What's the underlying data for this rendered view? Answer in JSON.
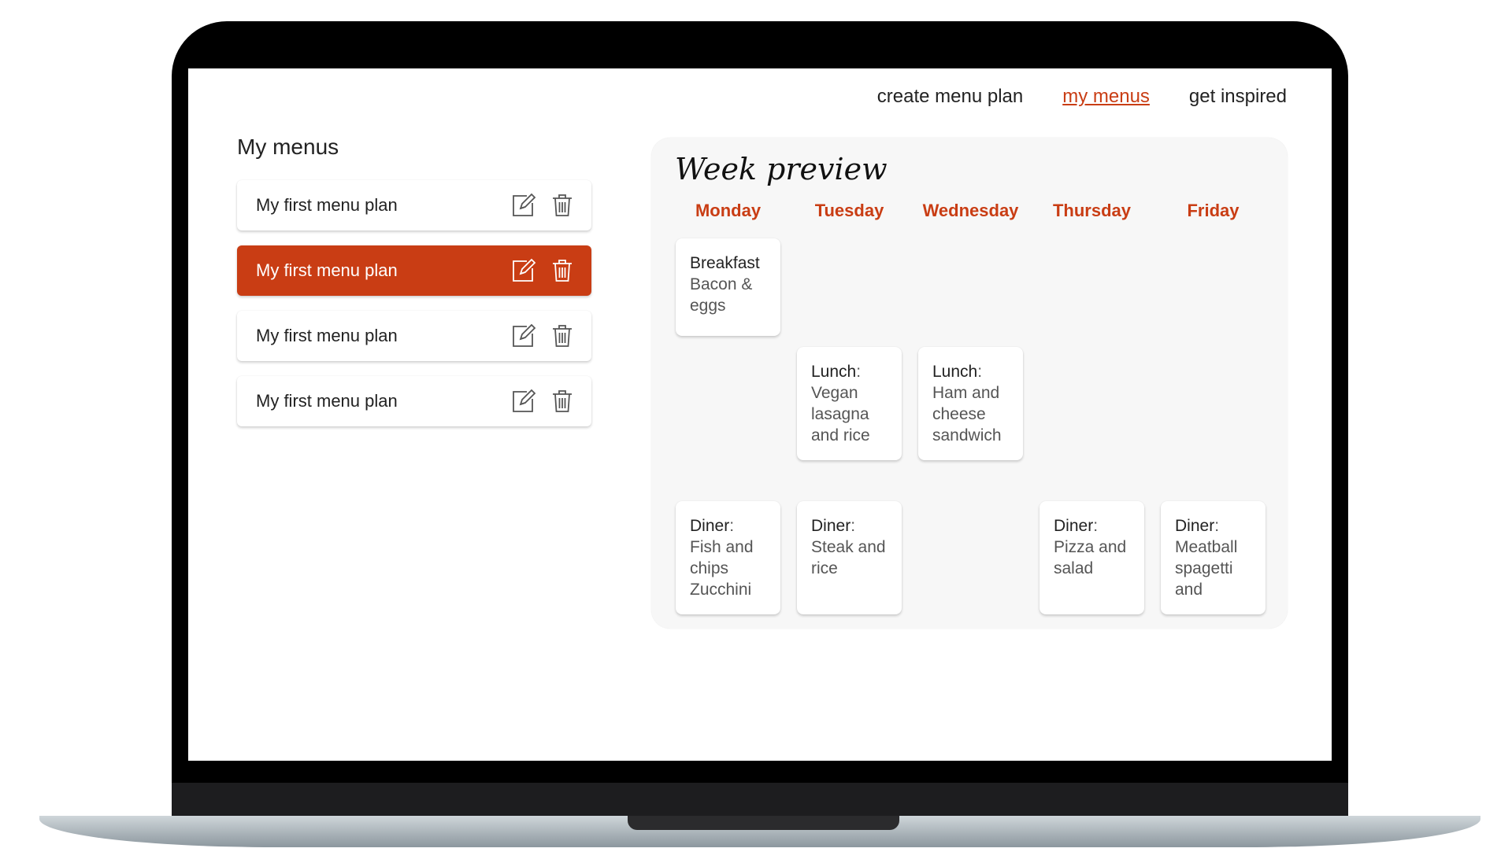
{
  "nav": {
    "items": [
      "create menu plan",
      "my menus",
      "get inspired"
    ],
    "active": "my menus"
  },
  "sidebar": {
    "title": "My menus",
    "items": [
      {
        "label": "My first menu plan",
        "selected": false
      },
      {
        "label": "My first menu plan",
        "selected": true
      },
      {
        "label": "My first menu plan",
        "selected": false
      },
      {
        "label": "My first menu plan",
        "selected": false
      }
    ],
    "item_icons": [
      "edit-icon",
      "trash-icon"
    ]
  },
  "preview": {
    "title": "Week preview",
    "days": [
      "Monday",
      "Tuesday",
      "Wednesday",
      "Thursday",
      "Friday"
    ],
    "meals": {
      "monday_breakfast": {
        "type": "Breakfast",
        "desc": "Bacon & eggs"
      },
      "tuesday_lunch": {
        "type": "Lunch",
        "desc": "Vegan lasagna and rice"
      },
      "wednesday_lunch": {
        "type": "Lunch",
        "desc": "Ham and cheese sandwich"
      },
      "monday_diner": {
        "type": "Diner",
        "desc": "Fish and chips Zucchini"
      },
      "tuesday_diner": {
        "type": "Diner",
        "desc": "Steak and rice"
      },
      "thursday_diner": {
        "type": "Diner",
        "desc": "Pizza and salad"
      },
      "friday_diner": {
        "type": "Diner",
        "desc": "Meatball spagetti and"
      }
    }
  },
  "colors": {
    "accent": "#c93d14",
    "text": "#222222",
    "preview_bg": "#f7f7f7"
  }
}
